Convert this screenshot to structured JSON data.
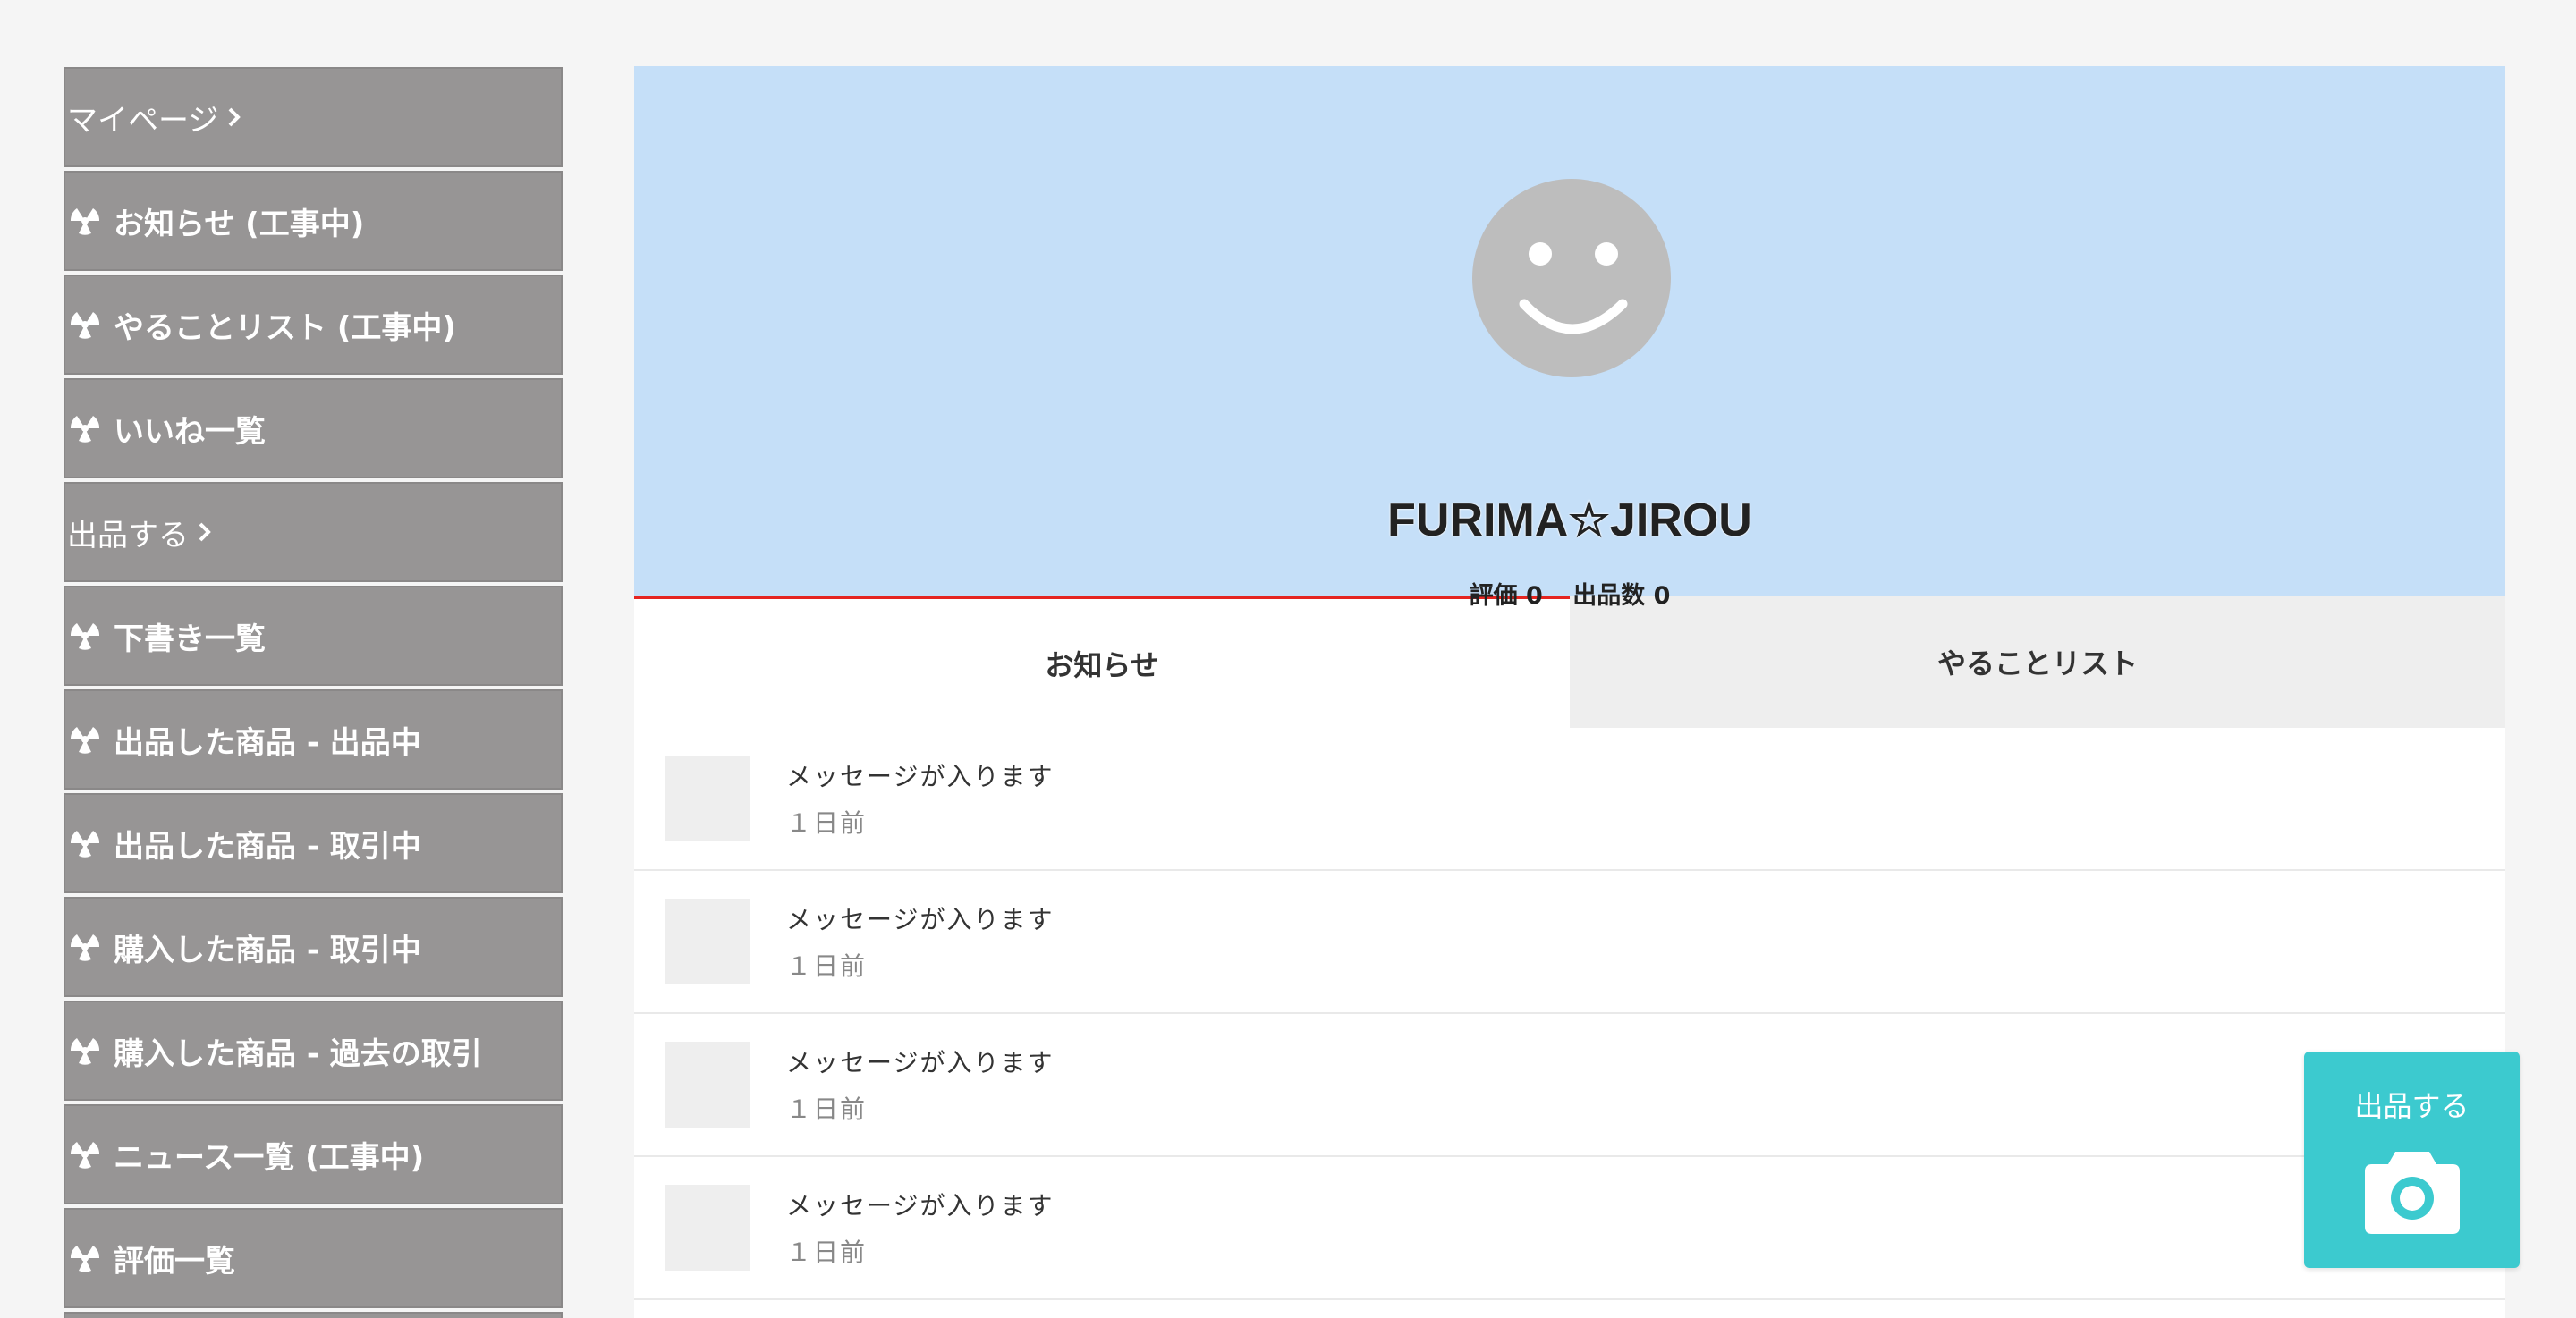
{
  "sidebar": {
    "items": [
      {
        "label": "マイページ",
        "type": "section"
      },
      {
        "label": "お知らせ (工事中)",
        "type": "link"
      },
      {
        "label": "やることリスト (工事中)",
        "type": "link"
      },
      {
        "label": "いいね一覧",
        "type": "link"
      },
      {
        "label": "出品する",
        "type": "section"
      },
      {
        "label": "下書き一覧",
        "type": "link"
      },
      {
        "label": "出品した商品 - 出品中",
        "type": "link"
      },
      {
        "label": "出品した商品 - 取引中",
        "type": "link"
      },
      {
        "label": "購入した商品 - 取引中",
        "type": "link"
      },
      {
        "label": "購入した商品 - 過去の取引",
        "type": "link"
      },
      {
        "label": "ニュース一覧 (工事中)",
        "type": "link"
      },
      {
        "label": "評価一覧",
        "type": "link"
      }
    ]
  },
  "profile": {
    "name": "FURIMA☆JIROU",
    "rating_label": "評価 0",
    "listings_label": "出品数 0"
  },
  "tabs": [
    {
      "label": "お知らせ",
      "active": true
    },
    {
      "label": "やることリスト",
      "active": false
    }
  ],
  "notices": [
    {
      "message": "メッセージが入ります",
      "time": "１日前"
    },
    {
      "message": "メッセージが入ります",
      "time": "１日前"
    },
    {
      "message": "メッセージが入ります",
      "time": "１日前"
    },
    {
      "message": "メッセージが入ります",
      "time": "１日前"
    }
  ],
  "sell_button": {
    "label": "出品する",
    "icon": "camera-icon"
  },
  "colors": {
    "sidebar_bg": "#979595",
    "hero_bg": "#c5dff8",
    "hero_pattern": "#4aa3c9",
    "active_tab_border": "#e52521",
    "fab_bg": "#3ccacf"
  }
}
